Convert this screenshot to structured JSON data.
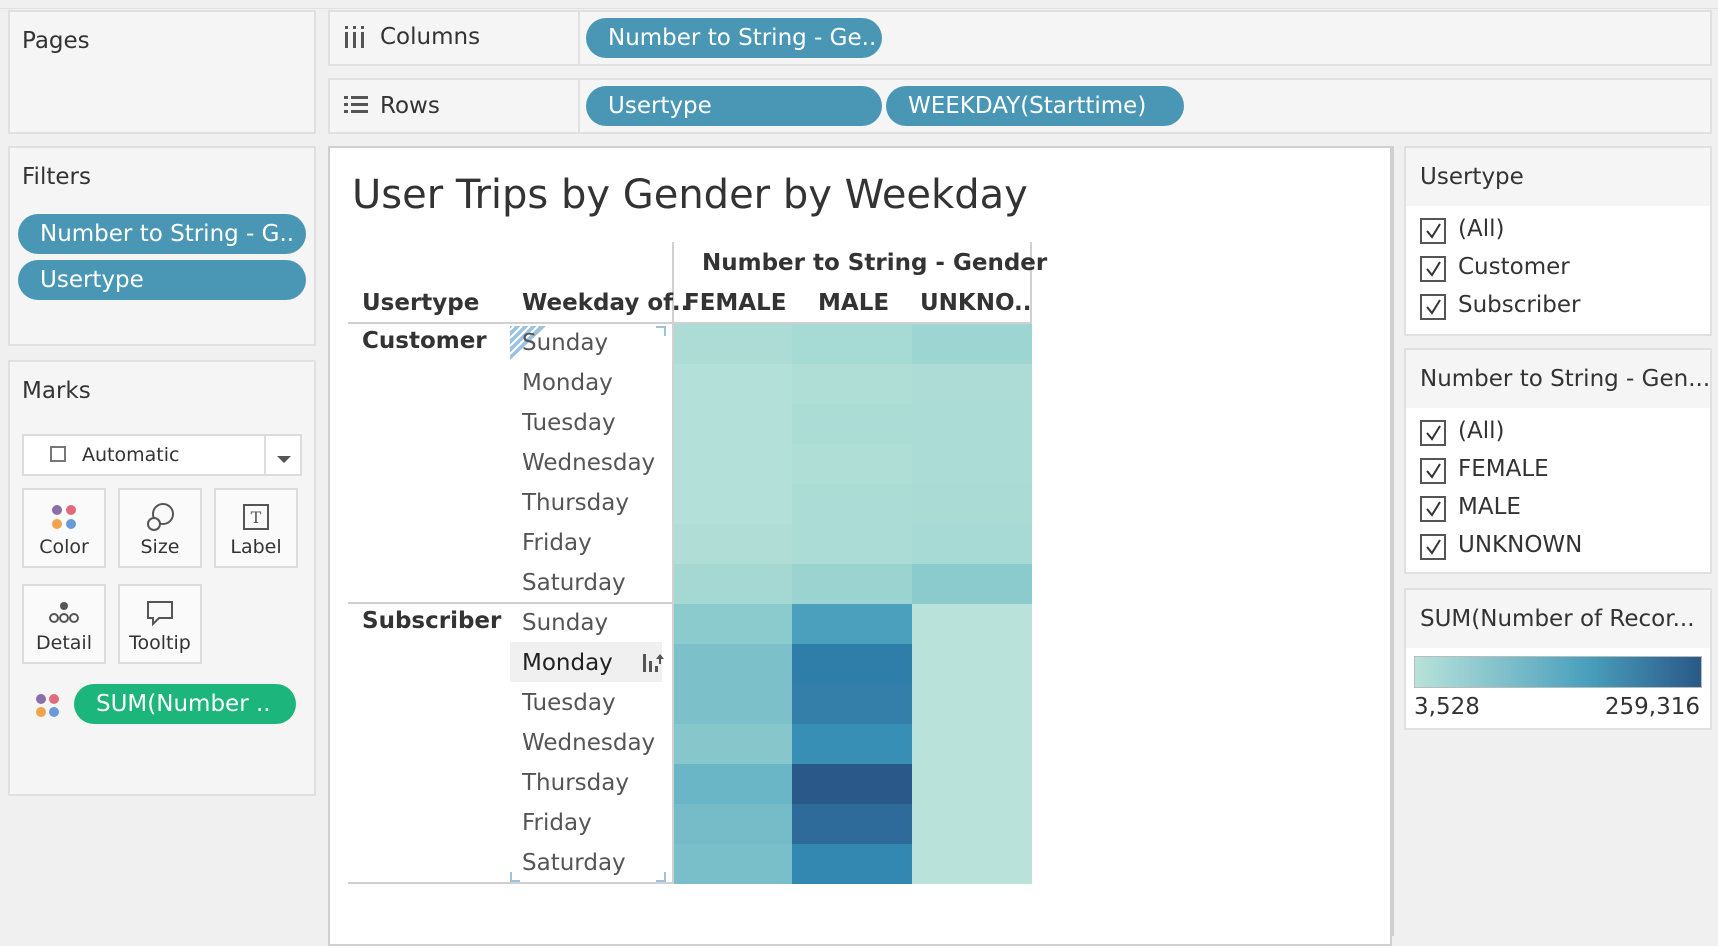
{
  "pages": {
    "title": "Pages"
  },
  "shelves": {
    "columns_label": "Columns",
    "rows_label": "Rows",
    "columns_pills": [
      "Number to String - Ge.."
    ],
    "rows_pills": [
      "Usertype",
      "WEEKDAY(Starttime)"
    ]
  },
  "filters": {
    "title": "Filters",
    "pills": [
      "Number to String - G..",
      "Usertype"
    ]
  },
  "marks": {
    "title": "Marks",
    "type_select": "Automatic",
    "buttons": {
      "color": "Color",
      "size": "Size",
      "label": "Label",
      "detail": "Detail",
      "tooltip": "Tooltip"
    },
    "field_pill": "SUM(Number .."
  },
  "viz": {
    "title": "User Trips by Gender by Weekday",
    "col_group_header": "Number to String - Gender",
    "row_header_usertype": "Usertype",
    "row_header_weekday": "Weekday of..",
    "columns": [
      "FEMALE",
      "MALE",
      "UNKNO.."
    ],
    "groups": [
      {
        "name": "Customer",
        "days": [
          "Sunday",
          "Monday",
          "Tuesday",
          "Wednesday",
          "Thursday",
          "Friday",
          "Saturday"
        ]
      },
      {
        "name": "Subscriber",
        "days": [
          "Sunday",
          "Monday",
          "Tuesday",
          "Wednesday",
          "Thursday",
          "Friday",
          "Saturday"
        ]
      }
    ],
    "heat_colors": [
      [
        [
          "#acdcd5",
          "#a6dad4",
          "#9dd5d2"
        ],
        [
          "#b3e0d8",
          "#afded6",
          "#acdcd5"
        ],
        [
          "#b3e0d8",
          "#acdcd6",
          "#acdcd6"
        ],
        [
          "#b3e0d8",
          "#afded6",
          "#acdcd6"
        ],
        [
          "#b3e0d8",
          "#acdcd6",
          "#aadbd5"
        ],
        [
          "#b0ded7",
          "#abdcd6",
          "#a7dad4"
        ],
        [
          "#a5d8d3",
          "#9bd3d1",
          "#8ccbcd"
        ]
      ],
      [
        [
          "#8bcacd",
          "#4aa0bd",
          "#b8e2da"
        ],
        [
          "#7cc1ca",
          "#2f7ea9",
          "#b8e2da"
        ],
        [
          "#7cc1ca",
          "#337fa9",
          "#b8e2da"
        ],
        [
          "#87c7cc",
          "#388fb5",
          "#b8e2da"
        ],
        [
          "#6bb6c6",
          "#2a5888",
          "#b8e2da"
        ],
        [
          "#75bcc8",
          "#2e6a9a",
          "#b8e2da"
        ],
        [
          "#79bfc9",
          "#3288b1",
          "#b8e2da"
        ]
      ]
    ],
    "selected_row_label": "Monday"
  },
  "legend_usertype": {
    "title": "Usertype",
    "items": [
      "(All)",
      "Customer",
      "Subscriber"
    ]
  },
  "legend_gender": {
    "title": "Number to String - Gen...",
    "items": [
      "(All)",
      "FEMALE",
      "MALE",
      "UNKNOWN"
    ]
  },
  "legend_color": {
    "title": "SUM(Number of Recor...",
    "min_label": "3,528",
    "max_label": "259,316",
    "gradient_start": "#b8e2da",
    "gradient_end": "#2a5888"
  }
}
